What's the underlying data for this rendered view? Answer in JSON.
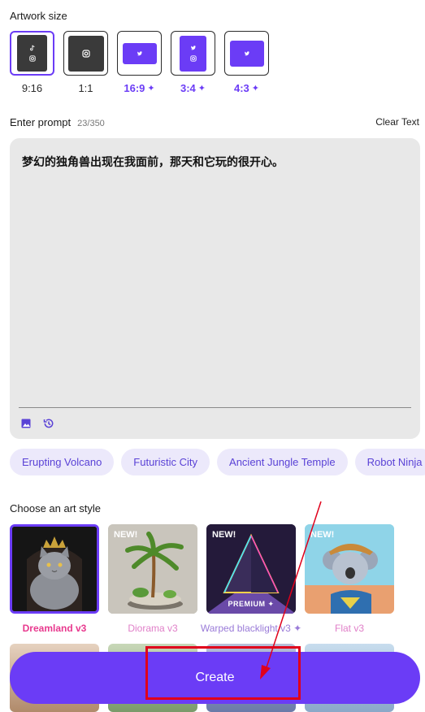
{
  "artwork_size": {
    "title": "Artwork size",
    "options": [
      {
        "label": "9:16",
        "premium": false,
        "selected": true
      },
      {
        "label": "1:1",
        "premium": false,
        "selected": false
      },
      {
        "label": "16:9",
        "premium": true,
        "selected": false
      },
      {
        "label": "3:4",
        "premium": true,
        "selected": false
      },
      {
        "label": "4:3",
        "premium": true,
        "selected": false
      }
    ],
    "sparkle": "✦"
  },
  "prompt": {
    "title": "Enter prompt",
    "count": "23/350",
    "clear_label": "Clear Text",
    "value": "梦幻的独角兽出现在我面前，那天和它玩的很开心。"
  },
  "suggestions": [
    "Erupting Volcano",
    "Futuristic City",
    "Ancient Jungle Temple",
    "Robot Ninja"
  ],
  "art_style": {
    "title": "Choose an art style",
    "items": [
      {
        "name": "Dreamland v3",
        "color": "#e8398e",
        "badge": ""
      },
      {
        "name": "Diorama v3",
        "color": "#e07fc8",
        "badge": "NEW!"
      },
      {
        "name": "Warped blacklight v3",
        "color": "#9a7bd8",
        "badge": "NEW!",
        "premium_label": "PREMIUM"
      },
      {
        "name": "Flat v3",
        "color": "#e07fc8",
        "badge": "NEW!"
      }
    ]
  },
  "create_label": "Create",
  "colors": {
    "accent": "#6b3cf6",
    "annotation": "#e0001b"
  }
}
